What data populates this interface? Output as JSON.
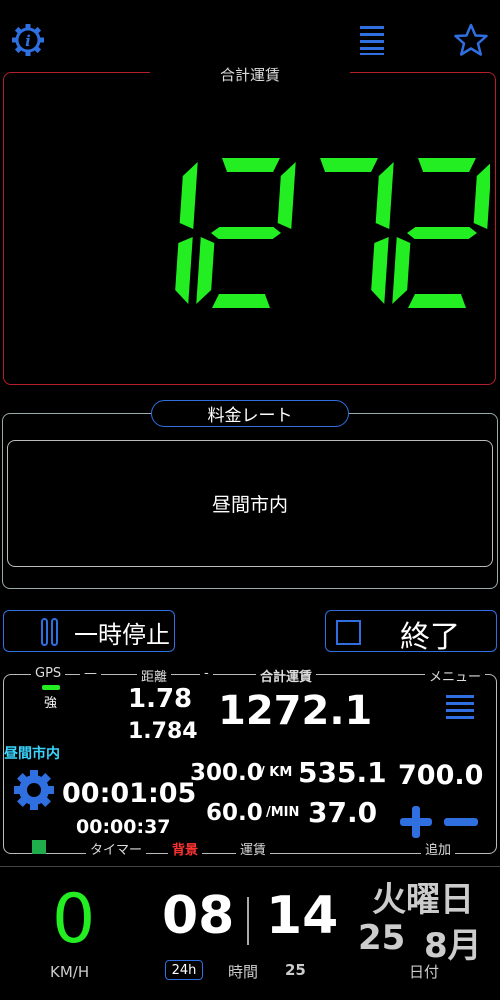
{
  "top": {
    "info_icon": "info-gear-icon",
    "menu_icon": "hamburger-icon",
    "star_icon": "star-icon"
  },
  "fare": {
    "title": "合計運賃",
    "amount": "1272"
  },
  "rate": {
    "title": "料金レート",
    "value": "昼間市内"
  },
  "actions": {
    "pause_label": "一時停止",
    "end_label": "終了"
  },
  "info": {
    "gps_label": "GPS",
    "gps_strength": "強",
    "distance_label": "距離",
    "distance_main": "1.78",
    "distance_sub": "1.784",
    "dash": "-",
    "total_label": "合計運賃",
    "total_value": "1272.1",
    "menu_label": "メニュー",
    "rate_name": "昼間市内",
    "timer_main": "00:01:05",
    "timer_sub": "00:00:37",
    "rate_per_km": "300.0",
    "unit_km": "/ KM",
    "km_value": "535.1",
    "rate_per_min": "60.0",
    "unit_min": "/MIN",
    "min_value": "37.0",
    "add_value": "700.0",
    "timer_label": "タイマー",
    "bg_label": "背景",
    "fare_label": "運賃",
    "add_label": "追加"
  },
  "bottom": {
    "speed": "0",
    "speed_unit": "KM/H",
    "hour": "08",
    "minute": "14",
    "mode_24h": "24h",
    "time_label": "時間",
    "seconds": "25",
    "weekday": "火曜日",
    "day": "25",
    "month": "8月",
    "date_label": "日付"
  },
  "colors": {
    "digit_green": "#22ee22",
    "accent_blue": "#2f6fe0",
    "border_red": "#b3202a",
    "rate_cyan": "#3ad6ff",
    "bg_red": "#ff3333"
  }
}
